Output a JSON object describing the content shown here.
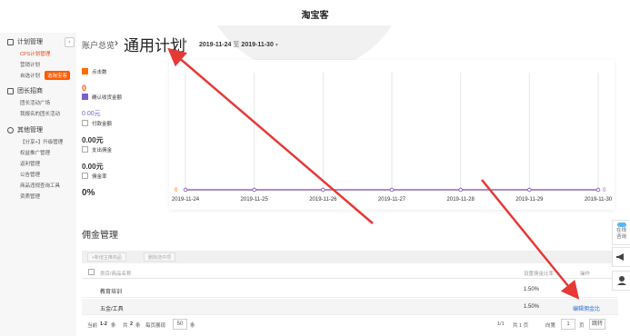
{
  "app": {
    "title": "淘宝客"
  },
  "sidebar": {
    "sections": [
      {
        "label": "计划管理",
        "items": [
          "CPS计划管理",
          "营销计划",
          "自选计划"
        ]
      },
      {
        "label": "团长招商",
        "items": [
          "团长活动广场",
          "我报名的团长活动"
        ]
      },
      {
        "label": "其他管理",
        "items": [
          "【分享+】升级管理",
          "权益推广管理",
          "返利管理",
          "公告管理",
          "商品违规查询工具",
          "资质管理"
        ]
      }
    ],
    "badge": "选淘宝客",
    "collapse_glyph": "‹"
  },
  "header": {
    "breadcrumb": "账户总览",
    "separator": "›",
    "plan_title": "通用计划",
    "plan_caret": "▼",
    "date_start": "2019-11-24",
    "date_sep": "至",
    "date_end": "2019-11-30",
    "date_caret": "▼"
  },
  "metrics": [
    {
      "label": "点击数",
      "value": "0",
      "checked": true,
      "color": "#ff6a00"
    },
    {
      "label": "确认收货金额",
      "value": "0.00元",
      "checked": true,
      "color": "#7b5fcc"
    },
    {
      "label": "付款金额",
      "value": "0.00元",
      "checked": false
    },
    {
      "label": "支出佣金",
      "value": "0.00元",
      "checked": false
    },
    {
      "label": "佣金率",
      "value": "0%",
      "checked": false
    }
  ],
  "chart_data": {
    "type": "line",
    "x": [
      "2019-11-24",
      "2019-11-25",
      "2019-11-26",
      "2019-11-27",
      "2019-11-28",
      "2019-11-29",
      "2019-11-30"
    ],
    "series": [
      {
        "name": "点击数",
        "values": [
          0,
          0,
          0,
          0,
          0,
          0,
          0
        ],
        "color": "#ff6a00"
      },
      {
        "name": "确认收货金额",
        "values": [
          0,
          0,
          0,
          0,
          0,
          0,
          0
        ],
        "color": "#7b5fcc"
      }
    ],
    "left_axis_label": "0",
    "right_axis_label": "0",
    "grid": "vertical"
  },
  "commission": {
    "title": "佣金管理",
    "toolbar": [
      "+新增主推商品",
      "删除选中项"
    ],
    "columns": [
      "类目/商品名称",
      "设置佣金比率",
      "操作"
    ],
    "rows": [
      {
        "name": "教育培训",
        "rate": "1.50%",
        "action": ""
      },
      {
        "name": "五金/工具",
        "rate": "1.50%",
        "action": "编辑佣金比"
      }
    ]
  },
  "pager": {
    "current_label": "当前",
    "range": "1-2",
    "items_unit": "条",
    "total_label": "共",
    "total": "2",
    "per_page_label": "每页展现",
    "per_page": "50",
    "page_info": "1/1",
    "pages_label": "共 1 页",
    "goto_label": "向第",
    "goto_value": "1",
    "page_unit": "页",
    "jump_label": "跳转"
  },
  "float": {
    "online": "在线\n咨询"
  },
  "colors": {
    "accent": "#ff5a00",
    "purple": "#7b5fcc",
    "link": "#2a6fd6",
    "arrow": "#e53935"
  }
}
